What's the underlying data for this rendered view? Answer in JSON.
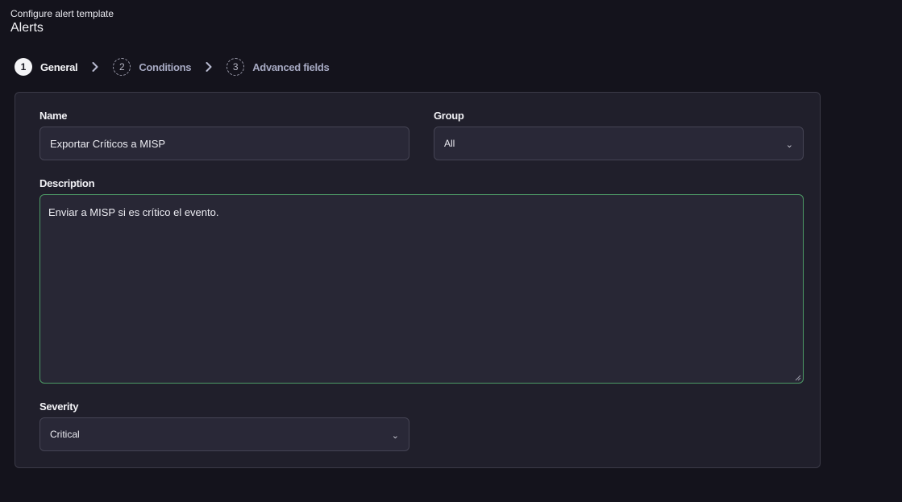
{
  "header": {
    "subtitle": "Configure alert template",
    "title": "Alerts"
  },
  "stepper": {
    "steps": [
      {
        "number": "1",
        "label": "General",
        "active": true
      },
      {
        "number": "2",
        "label": "Conditions",
        "active": false
      },
      {
        "number": "3",
        "label": "Advanced fields",
        "active": false
      }
    ]
  },
  "form": {
    "name": {
      "label": "Name",
      "value": "Exportar Críticos a MISP"
    },
    "group": {
      "label": "Group",
      "value": "All"
    },
    "description": {
      "label": "Description",
      "value": "Enviar a MISP si es crítico el evento."
    },
    "severity": {
      "label": "Severity",
      "value": "Critical"
    }
  },
  "icons": {
    "chevron": "chevron-right-icon",
    "caret": "chevron-down-icon"
  },
  "colors": {
    "background": "#14131c",
    "card": "#201f2b",
    "focus_border": "#4d9a66",
    "inactive_step_text": "#a6a9c2"
  }
}
